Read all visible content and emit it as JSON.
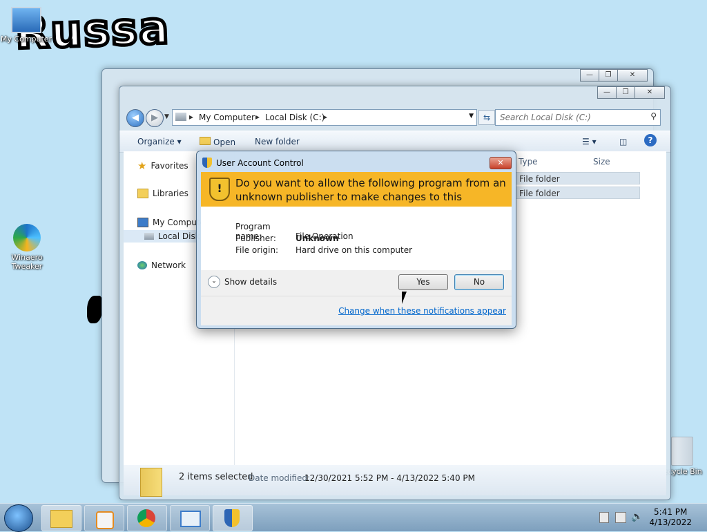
{
  "desktop": {
    "wallpaper_text": "Russa",
    "icons": [
      {
        "label": "My Computer"
      },
      {
        "label": "Winaero Tweaker"
      },
      {
        "label": "Recycle Bin"
      }
    ]
  },
  "explorer": {
    "address": {
      "crumbs": [
        "My Computer",
        "Local Disk (C:)"
      ]
    },
    "search": {
      "placeholder": "Search Local Disk (C:)"
    },
    "commands": {
      "organize": "Organize",
      "open": "Open",
      "new_folder": "New folder"
    },
    "columns": [
      "Type",
      "Size"
    ],
    "rows": [
      {
        "type": "File folder"
      },
      {
        "type": "File folder"
      }
    ],
    "nav": {
      "favorites": "Favorites",
      "libraries": "Libraries",
      "my_computer": "My Computer",
      "local_disk": "Local Disk (C:)",
      "network": "Network"
    },
    "details": {
      "selection": "2 items selected",
      "date_label": "Date modified:",
      "date_value": "12/30/2021 5:52 PM - 4/13/2022 5:40 PM"
    }
  },
  "uac": {
    "title": "User Account Control",
    "question": "Do you want to allow the following program from an unknown publisher to make changes to this computer?",
    "program_name_label": "Program name:",
    "program_name": "File Operation",
    "publisher_label": "Publisher:",
    "publisher": "Unknown",
    "origin_label": "File origin:",
    "origin": "Hard drive on this computer",
    "show_details": "Show details",
    "yes": "Yes",
    "no": "No",
    "change_link": "Change when these notifications appear"
  },
  "taskbar": {
    "time": "5:41 PM",
    "date": "4/13/2022"
  },
  "colors": {
    "uac_banner": "#f6b627",
    "desktop": "#bfe3f6",
    "link": "#0066cc"
  }
}
